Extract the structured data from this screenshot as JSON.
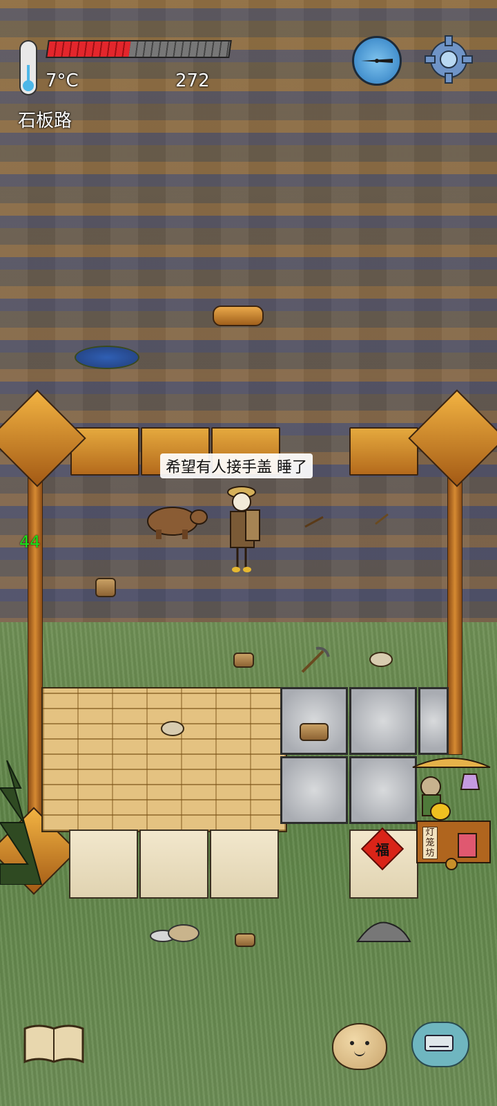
{
  "hud": {
    "temperature": "7°C",
    "health_fraction": 0.45,
    "score": "272",
    "location": "石板路"
  },
  "world": {
    "speech_bubble": "希望有人接手盖 睡了",
    "counter": "44",
    "fu_sign": "福",
    "stall_sign": "灯笼坊"
  },
  "icons": {
    "thermometer": "thermometer-icon",
    "compass": "compass-icon",
    "settings": "gear-icon",
    "journal": "book-icon",
    "character": "potato-face-icon",
    "chat": "keyboard-chat-icon"
  },
  "colors": {
    "health_red": "#e3262c",
    "counter_green": "#18e018",
    "hud_text": "#ffffff"
  }
}
